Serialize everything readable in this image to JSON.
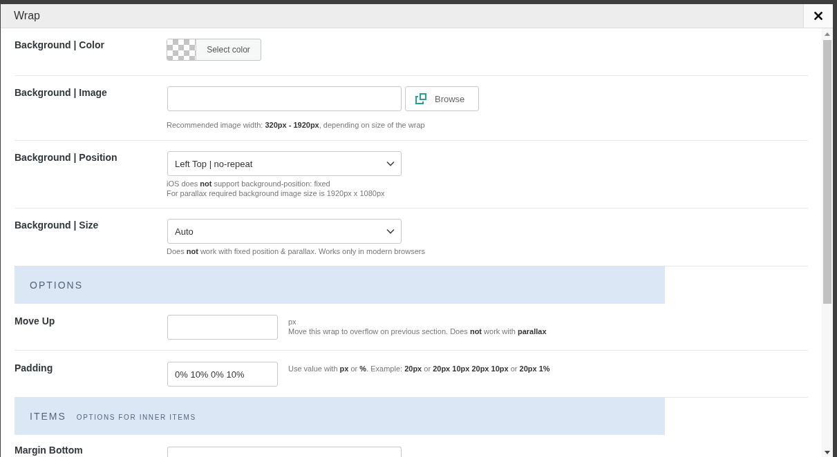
{
  "window": {
    "title": "Wrap"
  },
  "rows": [
    {
      "kind": "color",
      "label": "Background | Color",
      "button": "Select color"
    },
    {
      "kind": "file",
      "label": "Background | Image",
      "button": "Browse",
      "hint": [
        "Recommended image width: **320px - 1920px**, depending on size of the wrap"
      ]
    },
    {
      "kind": "select",
      "label": "Background | Position",
      "value": "Left Top | no-repeat",
      "hint": [
        "iOS does **not** support background-position: fixed",
        "For parallax required background image size is 1920px x 1080px"
      ]
    },
    {
      "kind": "select",
      "label": "Background | Size",
      "value": "Auto",
      "hint": [
        "Does **not** work with fixed position & parallax. Works only in modern browsers"
      ]
    },
    {
      "kind": "section",
      "title": "OPTIONS"
    },
    {
      "kind": "short_input",
      "label": "Move Up",
      "hint": [
        "px",
        "Move this wrap to overflow on previous section. Does **not** work with **parallax**"
      ]
    },
    {
      "kind": "short_input",
      "label": "Padding",
      "value": "0% 10% 0% 10%",
      "hint": [
        "Use value with **px** or **%**. Example: **20px** or **20px 10px 20px 10px** or **20px 1%**"
      ]
    },
    {
      "kind": "section",
      "title": "ITEMS",
      "subtitle": "OPTIONS FOR INNER ITEMS"
    },
    {
      "kind": "select",
      "label": "Margin Bottom"
    }
  ]
}
